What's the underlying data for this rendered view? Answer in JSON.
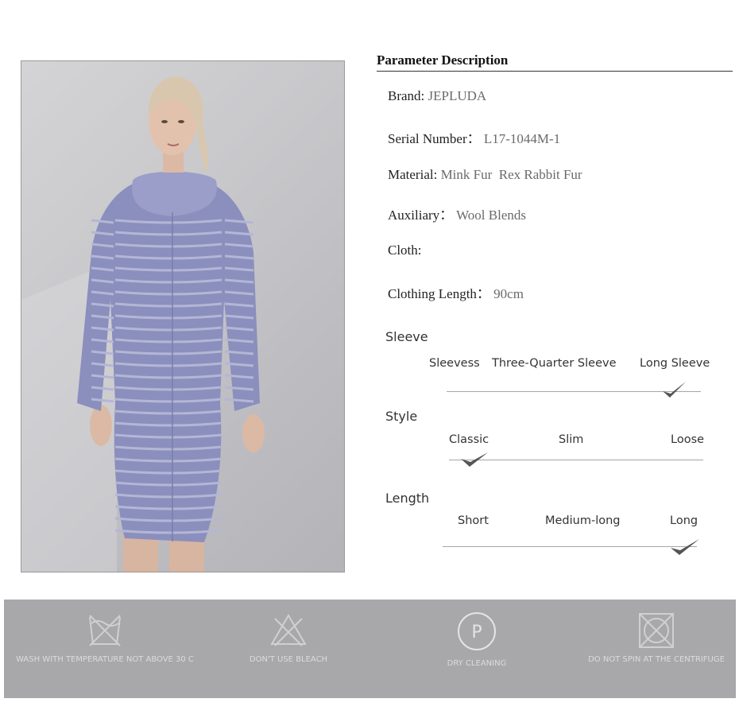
{
  "parameter": {
    "title": "Parameter Description",
    "rows": [
      {
        "label": "Brand:",
        "value": "JEPLUDA"
      },
      {
        "label": "Serial Number：",
        "value": "L17-1044M-1"
      },
      {
        "label": "Material:",
        "value": "Mink Fur  Rex Rabbit Fur"
      },
      {
        "label": "Auxiliary：",
        "value": "Wool Blends"
      },
      {
        "label": "Cloth:",
        "value": ""
      },
      {
        "label": "Clothing Length：",
        "value": "90cm"
      }
    ]
  },
  "scales": {
    "sleeve": {
      "label": "Sleeve",
      "options": [
        "Sleevess",
        "Three-Quarter Sleeve",
        "Long Sleeve"
      ],
      "selected": "Long Sleeve"
    },
    "style": {
      "label": "Style",
      "options": [
        "Classic",
        "Slim",
        "Loose"
      ],
      "selected": "Classic"
    },
    "length": {
      "label": "Length",
      "options": [
        "Short",
        "Medium-long",
        "Long"
      ],
      "selected": "Long"
    }
  },
  "care": [
    {
      "icon": "no-wash-icon",
      "text": "WASH WITH TEMPERATURE NOT ABOVE 30 C"
    },
    {
      "icon": "no-bleach-icon",
      "text": "DON'T USE BLEACH"
    },
    {
      "icon": "dry-clean-icon",
      "text": "DRY CLEANING",
      "symbol": "P"
    },
    {
      "icon": "no-spin-icon",
      "text": "DO NOT SPIN AT THE CENTRIFUGE"
    }
  ],
  "colors": {
    "coat": "#8b8fbd",
    "stripe": "#b4b6d6",
    "care_bar": "#a8a8aa"
  }
}
